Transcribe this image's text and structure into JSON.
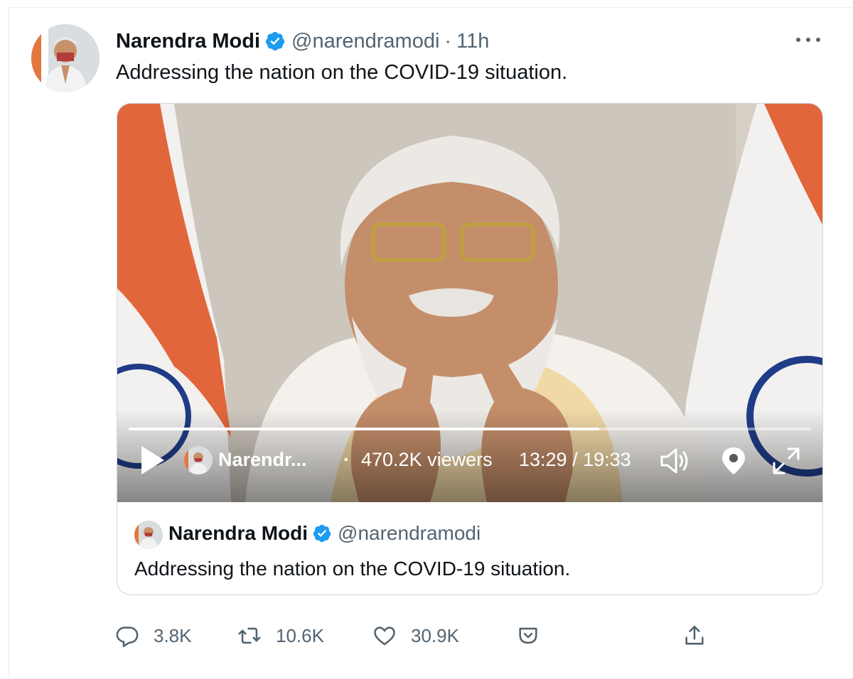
{
  "tweet": {
    "author_name": "Narendra Modi",
    "handle": "@narendramodi",
    "separator": "·",
    "time": "11h",
    "text": "Addressing the nation on the COVID-19 situation.",
    "more_icon": "more-horizontal-icon"
  },
  "video": {
    "progress_fraction": 0.69,
    "broadcaster": "Narendr...",
    "dot": "·",
    "viewers": "470.2K viewers",
    "timecode": "13:29 / 19:33",
    "icons": [
      "play-icon",
      "volume-icon",
      "location-pin-icon",
      "fullscreen-icon"
    ]
  },
  "quoted": {
    "author_name": "Narendra Modi",
    "handle": "@narendramodi",
    "text": "Addressing the nation on the COVID-19 situation."
  },
  "actions": {
    "replies": "3.8K",
    "retweets": "10.6K",
    "likes": "30.9K"
  },
  "colors": {
    "verified": "#1d9bf0",
    "secondary_text": "#536471",
    "border": "#cfd9de"
  }
}
